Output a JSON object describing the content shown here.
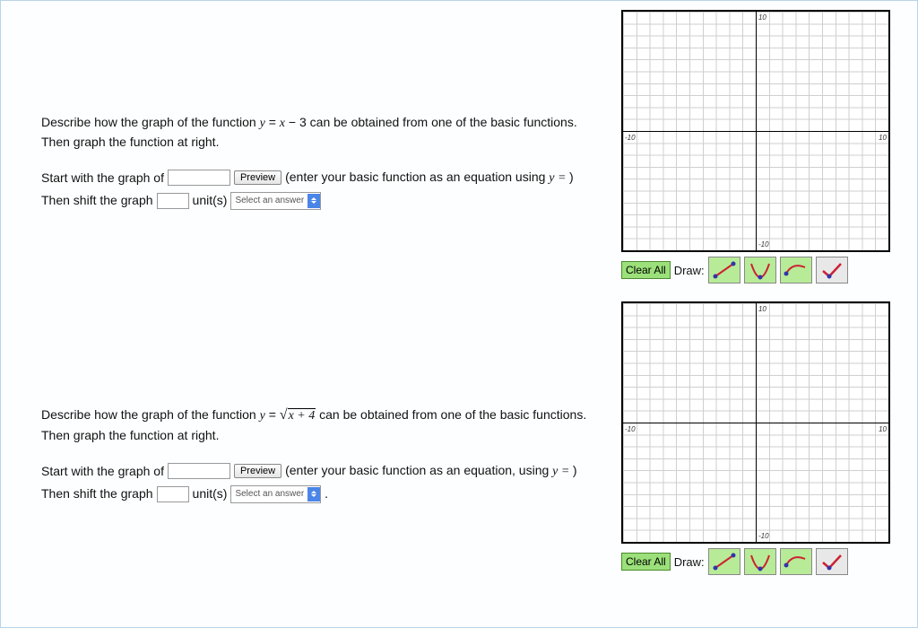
{
  "problems": [
    {
      "prompt_pre": "Describe how the graph of the function ",
      "equation": {
        "lhs": "y",
        "rhs_pre": "x",
        "op": "−",
        "const": "3"
      },
      "prompt_post": " can be obtained from one of the basic functions. Then graph the function at right.",
      "line1_start": "Start with the graph of",
      "preview_label": "Preview",
      "hint": "(enter your basic function as an equation using ",
      "hint_eq": "y = ",
      "hint_close": ")",
      "line2_start": "Then shift the graph",
      "units_label": "unit(s)",
      "select_placeholder": "Select an answer",
      "period": "",
      "grid": {
        "min": -10,
        "max": 10
      },
      "toolbar": {
        "clear": "Clear All",
        "draw": "Draw:"
      }
    },
    {
      "prompt_pre": "Describe how the graph of the function ",
      "equation": {
        "lhs": "y",
        "sqrt_arg": "x + 4"
      },
      "prompt_post": " can be obtained from one of the basic functions. Then graph the function at right.",
      "line1_start": "Start with the graph of",
      "preview_label": "Preview",
      "hint": "(enter your basic function as an equation, using ",
      "hint_eq": "y = ",
      "hint_close": ")",
      "line2_start": "Then shift the graph",
      "units_label": "unit(s)",
      "select_placeholder": "Select an answer",
      "period": ".",
      "grid": {
        "min": -10,
        "max": 10
      },
      "toolbar": {
        "clear": "Clear All",
        "draw": "Draw:"
      }
    }
  ],
  "chart_data": [
    {
      "type": "scatter",
      "title": "",
      "xlabel": "",
      "ylabel": "",
      "xlim": [
        -10,
        10
      ],
      "ylim": [
        -10,
        10
      ],
      "series": [],
      "grid": true
    },
    {
      "type": "scatter",
      "title": "",
      "xlabel": "",
      "ylabel": "",
      "xlim": [
        -10,
        10
      ],
      "ylim": [
        -10,
        10
      ],
      "series": [],
      "grid": true
    }
  ],
  "tool_icons": [
    "line-segment-icon",
    "parabola-icon",
    "curve-icon",
    "check-icon"
  ]
}
